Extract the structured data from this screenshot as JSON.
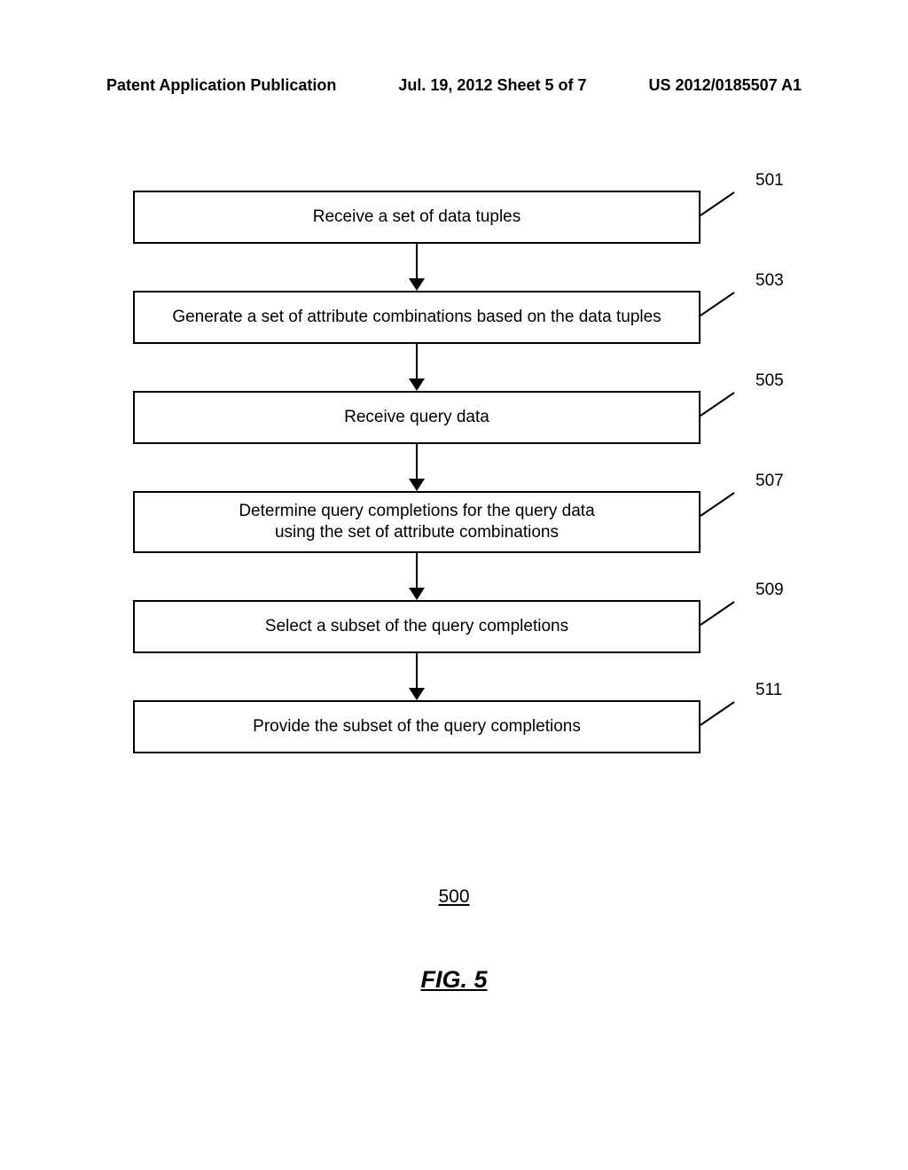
{
  "header": {
    "left": "Patent Application Publication",
    "mid": "Jul. 19, 2012  Sheet 5 of 7",
    "right": "US 2012/0185507 A1"
  },
  "flow": {
    "steps": [
      {
        "ref": "501",
        "text": "Receive a set of data tuples"
      },
      {
        "ref": "503",
        "text": "Generate a set of attribute combinations based on the data tuples"
      },
      {
        "ref": "505",
        "text": "Receive query data"
      },
      {
        "ref": "507",
        "text": "Determine query completions for the query data\nusing the set of attribute combinations"
      },
      {
        "ref": "509",
        "text": "Select a subset of the query completions"
      },
      {
        "ref": "511",
        "text": "Provide the subset of the query completions"
      }
    ],
    "figure_number": "500",
    "figure_label": "FIG. 5"
  }
}
